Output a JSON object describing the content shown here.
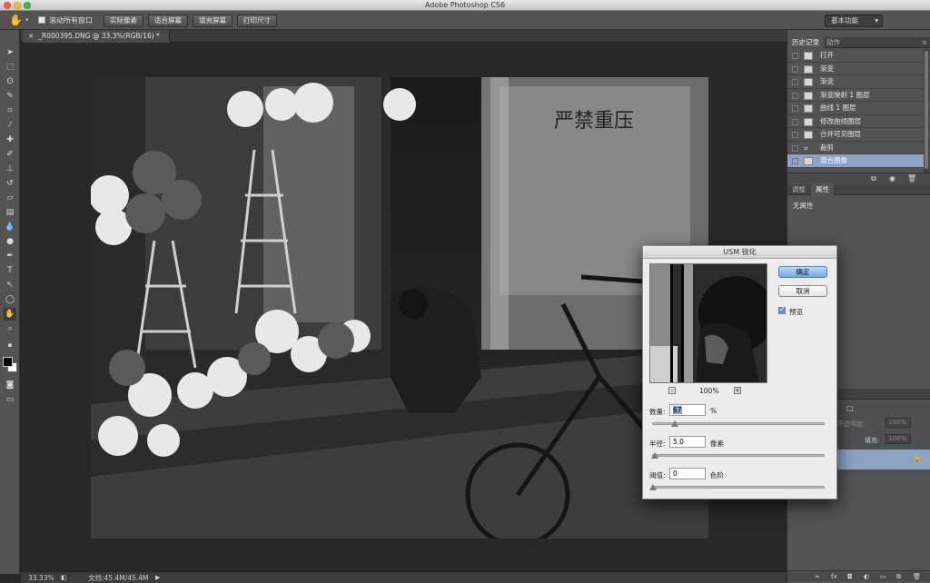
{
  "window": {
    "title": "Adobe Photoshop CS6"
  },
  "options_bar": {
    "scroll_all_label": "滚动所有窗口",
    "buttons": [
      "实际像素",
      "适合屏幕",
      "填充屏幕",
      "打印尺寸"
    ],
    "workspace": "基本功能"
  },
  "document": {
    "tab_title": "_R000395.DNG @ 33.3%(RGB/16) *"
  },
  "status": {
    "zoom": "33.33%",
    "doc_size": "文档:45.4M/45.4M"
  },
  "panels": {
    "history_tabs": [
      "历史记录",
      "动作"
    ],
    "history_items": [
      "打开",
      "渐变",
      "渐变",
      "渐变映射 1 图层",
      "曲线 1 图层",
      "修改曲线图层",
      "合并可见图层",
      "裁剪",
      "混合图像"
    ],
    "properties_tabs": [
      "调整",
      "属性"
    ],
    "properties_text": "无属性",
    "layers": {
      "opacity_label": "不透明度:",
      "opacity_value": "100%",
      "fill_label": "填充:",
      "fill_value": "100%"
    }
  },
  "dialog": {
    "title": "USM 锐化",
    "ok": "确定",
    "cancel": "取消",
    "preview_label": "预览",
    "zoom": "100%",
    "amount_label": "数量:",
    "amount_value": "67",
    "amount_unit": "%",
    "radius_label": "半径:",
    "radius_value": "5.0",
    "radius_unit": "像素",
    "threshold_label": "阈值:",
    "threshold_value": "0",
    "threshold_unit": "色阶",
    "amount_level": 0.13,
    "radius_level": 0.01,
    "threshold_level": 0.0
  },
  "colors": {
    "accent": "#8ca3c4",
    "panel": "#535353",
    "canvas": "#282828"
  }
}
